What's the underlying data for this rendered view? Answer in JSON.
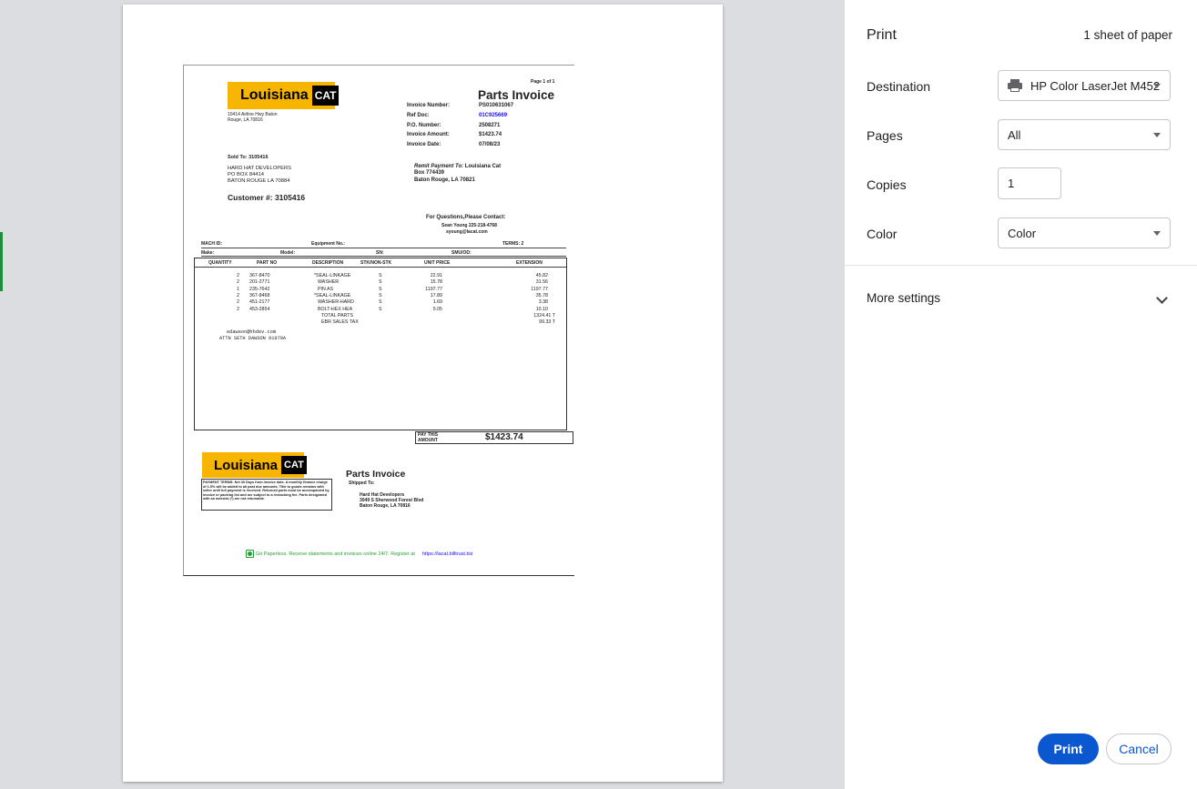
{
  "dialog": {
    "title": "Print",
    "sheet_count": "1 sheet of paper",
    "destination_label": "Destination",
    "destination_value": "HP Color LaserJet M452",
    "pages_label": "Pages",
    "pages_value": "All",
    "copies_label": "Copies",
    "copies_value": "1",
    "color_label": "Color",
    "color_value": "Color",
    "more_settings": "More settings",
    "print_button": "Print",
    "cancel_button": "Cancel"
  },
  "invoice": {
    "page": "Page 1 of 1",
    "title": "Parts Invoice",
    "logo_word": "Louisiana",
    "logo_cat": "CAT",
    "address1": "10414 Airline Hwy Baton",
    "address2": "Rouge, LA 70816",
    "fields": [
      {
        "label": "Invoice Number:",
        "value": "PS010631067"
      },
      {
        "label": "Ref Doc:",
        "value": "01C925669"
      },
      {
        "label": "P.O. Number:",
        "value": "2508271"
      },
      {
        "label": "Invoice Amount:",
        "value": "$1423.74"
      },
      {
        "label": "Invoice Date:",
        "value": "07/08/23"
      }
    ],
    "sold_to": "Sold To: 3105416",
    "sold_lines": [
      "HARD HAT DEVELOPERS",
      "PO BOX 84414",
      "BATON ROUGE LA 70884"
    ],
    "customer_no": "Customer #: 3105416",
    "remit_label": "Remit Payment To:",
    "remit_name": " Louisiana Cat",
    "remit_lines": [
      "Box 774439",
      "Baton Rouge, LA 70821"
    ],
    "questions": "For Questions,Please Contact:",
    "contact1": "Sean Young 225-218-4768",
    "contact2": "syoung@lacat.com",
    "mach_id": "MACH ID:",
    "equipment": "Equipment No.:",
    "terms": "TERMS:  2",
    "make": "Make:",
    "model": "Model:",
    "sn": "SN:",
    "smu": "SMU/OD:",
    "headers": [
      "QUANTITY",
      "PART NO",
      "DESCRIPTION",
      "STK/NON-STK",
      "UNIT PRICE",
      "EXTENSION"
    ],
    "items": [
      {
        "qty": "2",
        "part": "367-8470",
        "desc": "*SEAL-LINKAGE",
        "stk": "S",
        "price": "22.91",
        "ext": "45.82"
      },
      {
        "qty": "2",
        "part": "201-2771",
        "desc": "WASHER",
        "stk": "S",
        "price": "15.78",
        "ext": "31.56"
      },
      {
        "qty": "1",
        "part": "235-7642",
        "desc": "PIN AS",
        "stk": "S",
        "price": "1197.77",
        "ext": "1197.77"
      },
      {
        "qty": "2",
        "part": "367-8468",
        "desc": "*SEAL-LINKAGE",
        "stk": "S",
        "price": "17.89",
        "ext": "35.78"
      },
      {
        "qty": "2",
        "part": "451-2177",
        "desc": "WASHER-HARD",
        "stk": "S",
        "price": "1.69",
        "ext": "3.38"
      },
      {
        "qty": "2",
        "part": "453-2854",
        "desc": "BOLT-HEX HEA",
        "stk": "S",
        "price": "5.05",
        "ext": "10.10"
      }
    ],
    "total_label": "TOTAL PARTS",
    "total_value": "1324.41 T",
    "tax_label": "EBR SALES TAX",
    "tax_value": "99.33 T",
    "email": "edawson@hhdev.com",
    "attn": "ATTN SETH DAWSON 91979A",
    "pay_label1": "PAY THIS",
    "pay_label2": "AMOUNT",
    "pay_amount": "$1423.74",
    "stub_title": "Parts Invoice",
    "shipped_to": "Shipped To:",
    "ship_lines": [
      "Hard Hat Developers",
      "3049 S Sherwood Forest Blvd",
      "Baton Rouge, LA 70816"
    ],
    "payment_terms": "PAYMENT TERMS: Net 30 Days from invoice date. A monthly finance charge of 1.5% will be added to all past due amounts. Title to goods remains with seller until full payment is received. Returned parts must be accompanied by invoice or packing list and are subject to a restocking fee. Parts designated with an asterisk (*) are not returnable.",
    "paperless": "Go Paperless.  Receive statements and invoices online 24/7. Register at",
    "paperless_link": "https://lacat.billtrust.biz"
  },
  "colors": {
    "accent": "#0b57d0",
    "logo_yellow": "#f7b500",
    "link_blue": "#1a0dff",
    "paperless_green": "#2a9d3a"
  }
}
